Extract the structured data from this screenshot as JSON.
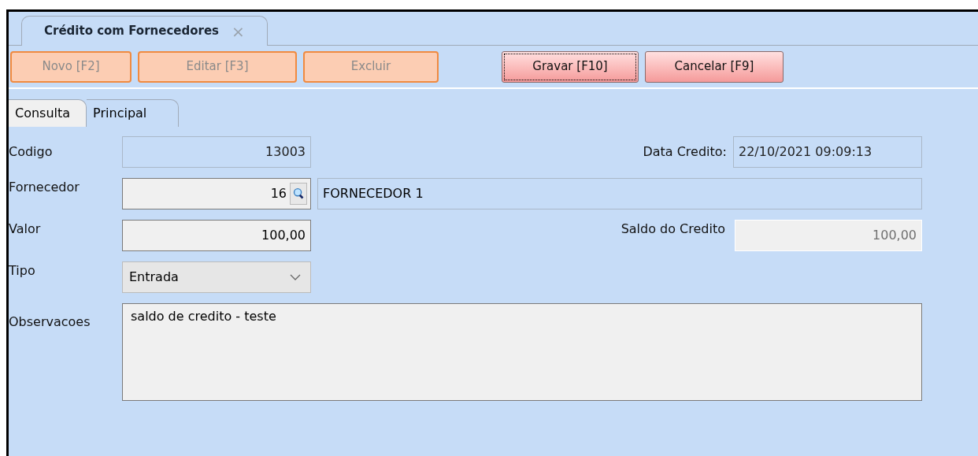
{
  "document_tab": {
    "title": "Crédito com Fornecedores",
    "close": "×"
  },
  "toolbar": [
    {
      "label": "Novo [F2]",
      "kind": "edit",
      "disabled": true,
      "focused": false
    },
    {
      "label": "Editar [F3]",
      "kind": "edit",
      "disabled": true,
      "focused": false
    },
    {
      "label": "Excluir",
      "kind": "edit",
      "disabled": true,
      "focused": false
    },
    {
      "label": "Gravar [F10]",
      "kind": "save",
      "disabled": false,
      "focused": true
    },
    {
      "label": "Cancelar [F9]",
      "kind": "save",
      "disabled": false,
      "focused": false
    }
  ],
  "tabs": [
    {
      "label": "Consulta",
      "selected": false
    },
    {
      "label": "Principal",
      "selected": true
    }
  ],
  "form": {
    "codigo": {
      "label": "Codigo",
      "value": "13003",
      "disabled": true
    },
    "data_credito": {
      "label": "Data Credito:",
      "value": "22/10/2021 09:09:13",
      "disabled": true
    },
    "fornecedor": {
      "label": "Fornecedor",
      "value": "16",
      "name": "FORNECEDOR 1",
      "disabled": false
    },
    "valor": {
      "label": "Valor",
      "value": "100,00",
      "disabled": false
    },
    "saldo": {
      "label": "Saldo do Credito",
      "value": "100,00",
      "disabled": true
    },
    "tipo": {
      "label": "Tipo",
      "value": "Entrada"
    },
    "observacoes": {
      "label": "Observacoes",
      "value": "saldo de credito - teste"
    }
  }
}
